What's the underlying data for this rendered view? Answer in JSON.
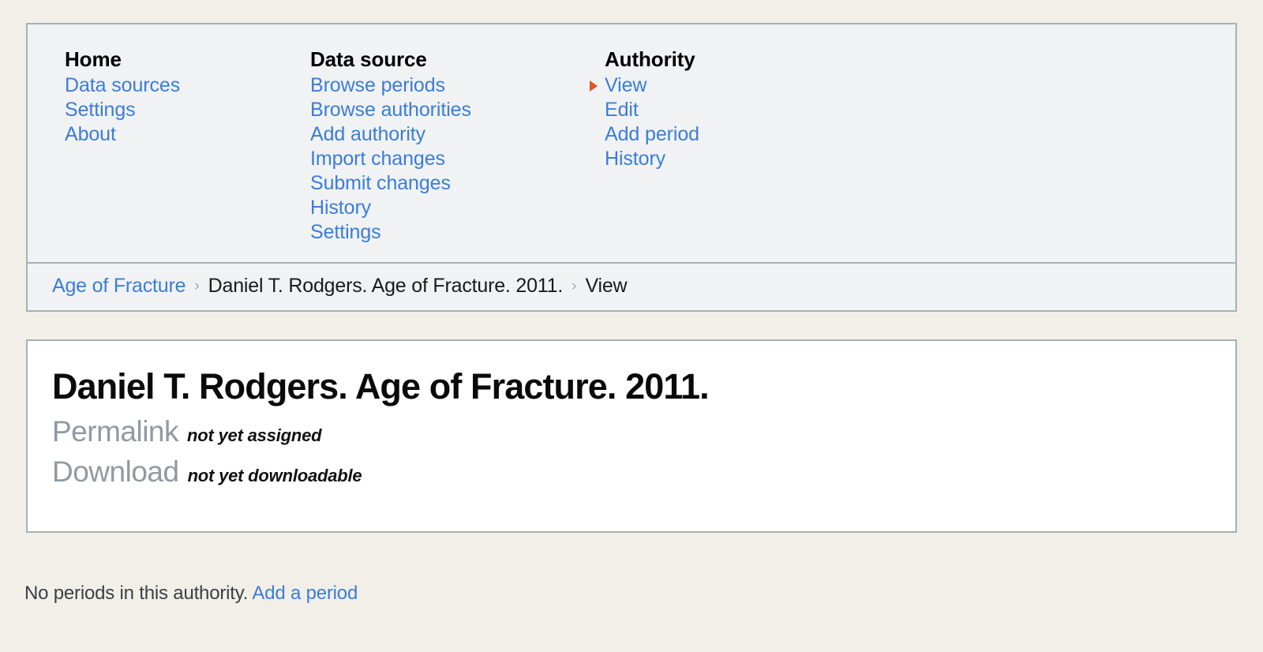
{
  "nav": {
    "columns": [
      {
        "heading": "Home",
        "items": [
          {
            "label": "Data sources",
            "current": false
          },
          {
            "label": "Settings",
            "current": false
          },
          {
            "label": "About",
            "current": false
          }
        ]
      },
      {
        "heading": "Data source",
        "items": [
          {
            "label": "Browse periods",
            "current": false
          },
          {
            "label": "Browse authorities",
            "current": false
          },
          {
            "label": "Add authority",
            "current": false
          },
          {
            "label": "Import changes",
            "current": false
          },
          {
            "label": "Submit changes",
            "current": false
          },
          {
            "label": "History",
            "current": false
          },
          {
            "label": "Settings",
            "current": false
          }
        ]
      },
      {
        "heading": "Authority",
        "items": [
          {
            "label": "View",
            "current": true
          },
          {
            "label": "Edit",
            "current": false
          },
          {
            "label": "Add period",
            "current": false
          },
          {
            "label": "History",
            "current": false
          },
          {
            "label": "",
            "current": false
          }
        ]
      }
    ]
  },
  "breadcrumb": {
    "separator": "›",
    "items": [
      {
        "label": "Age of Fracture",
        "link": true
      },
      {
        "label": "Daniel T. Rodgers. Age of Fracture. 2011.",
        "link": false
      },
      {
        "label": "View",
        "link": false
      }
    ]
  },
  "card": {
    "title": "Daniel T. Rodgers. Age of Fracture. 2011.",
    "rows": [
      {
        "label": "Permalink",
        "value": "not yet assigned"
      },
      {
        "label": "Download",
        "value": "not yet downloadable"
      }
    ]
  },
  "footer": {
    "message": "No periods in this authority.",
    "link_label": "Add a period"
  },
  "colors": {
    "page_background": "#f2efe9",
    "panel_background": "#f0f2f4",
    "panel_border": "#a7b0b8",
    "link": "#3b7dd8",
    "current_marker": "#e4512a",
    "meta_label": "#9199a1",
    "card_background": "#ffffff"
  }
}
